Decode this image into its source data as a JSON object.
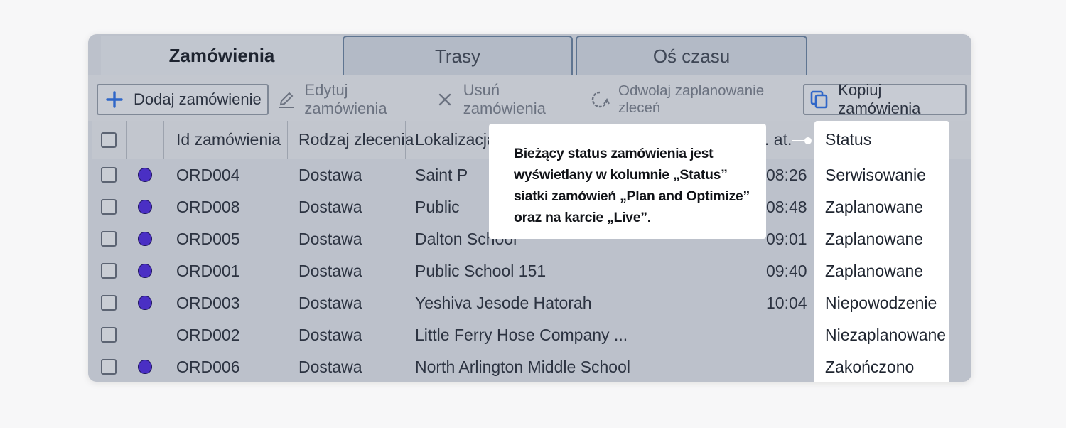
{
  "tabs": [
    {
      "label": "Zamówienia",
      "active": true
    },
    {
      "label": "Trasy",
      "active": false
    },
    {
      "label": "Oś czasu",
      "active": false
    }
  ],
  "toolbar": {
    "add": {
      "label": "Dodaj zamówienie",
      "icon": "plus-icon"
    },
    "edit": {
      "label": "Edytuj zamówienia",
      "icon": "pencil-icon"
    },
    "delete": {
      "label": "Usuń zamówienia",
      "icon": "close-icon"
    },
    "unschedule": {
      "label": "Odwołaj zaplanowanie zleceń",
      "icon": "undo-icon"
    },
    "copy": {
      "label": "Kopiuj zamówienia",
      "icon": "copy-icon"
    }
  },
  "grid": {
    "columns": {
      "id": "Id zamówienia",
      "type": "Rodzaj zlecenia",
      "location": "Lokalizacja",
      "time": ". at.",
      "status": "Status"
    },
    "rows": [
      {
        "id": "ORD004",
        "type": "Dostawa",
        "location": "Saint P",
        "time": "08:26",
        "status": "Serwisowanie",
        "dot": true
      },
      {
        "id": "ORD008",
        "type": "Dostawa",
        "location": "Public",
        "time": "08:48",
        "status": "Zaplanowane",
        "dot": true
      },
      {
        "id": "ORD005",
        "type": "Dostawa",
        "location": "Dalton School",
        "time": "09:01",
        "status": "Zaplanowane",
        "dot": true
      },
      {
        "id": "ORD001",
        "type": "Dostawa",
        "location": "Public School 151",
        "time": "09:40",
        "status": "Zaplanowane",
        "dot": true
      },
      {
        "id": "ORD003",
        "type": "Dostawa",
        "location": "Yeshiva Jesode Hatorah",
        "time": "10:04",
        "status": "Niepowodzenie",
        "dot": true
      },
      {
        "id": "ORD002",
        "type": "Dostawa",
        "location": "Little Ferry Hose Company ...",
        "time": "",
        "status": "Niezaplanowane",
        "dot": false
      },
      {
        "id": "ORD006",
        "type": "Dostawa",
        "location": "North Arlington Middle School",
        "time": "",
        "status": "Zakończono",
        "dot": true
      }
    ]
  },
  "callout": {
    "text": "Bieżący status zamówienia jest wyświetlany w kolumnie „Status” siatki zamówień „Plan and Optimize” oraz na karcie „Live”."
  },
  "colors": {
    "dot": "#4a2fc4",
    "highlight": "#ffffff",
    "panel": "#bcc1cb"
  }
}
